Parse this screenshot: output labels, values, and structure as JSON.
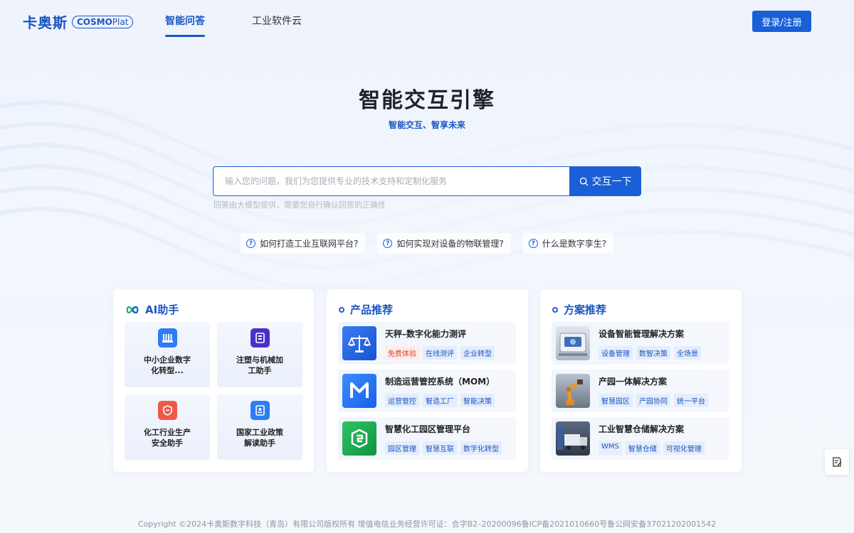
{
  "header": {
    "logo_cn": "卡奥斯",
    "logo_en_a": "COSMO",
    "logo_en_b": "Plat",
    "nav": [
      {
        "label": "智能问答",
        "active": true
      },
      {
        "label": "工业软件云",
        "active": false
      }
    ],
    "login_label": "登录/注册"
  },
  "hero": {
    "title": "智能交互引擎",
    "subtitle": "智能交互、智享未来"
  },
  "search": {
    "placeholder": "输入您的问题，我们为您提供专业的技术支持和定制化服务",
    "button_label": "交互一下",
    "note": "回答由大模型提供，需要您自行确认回答的正确性"
  },
  "questions": [
    "如何打造工业互联网平台?",
    "如何实现对设备的物联管理?",
    "什么是数字孪生?"
  ],
  "ai_assistant": {
    "title": "AI助手",
    "items": [
      {
        "label": "中小企业数字化转型...",
        "icon": "factory-icon",
        "color": "#2f7cf6"
      },
      {
        "label": "注塑与机械加工助手",
        "icon": "machine-icon",
        "color": "#4b2fc9"
      },
      {
        "label": "化工行业生产安全助手",
        "icon": "safety-icon",
        "color": "#ee5a48"
      },
      {
        "label": "国家工业政策解读助手",
        "icon": "policy-icon",
        "color": "#2f7cf6"
      }
    ]
  },
  "products": {
    "title": "产品推荐",
    "items": [
      {
        "name": "天秤–数字化能力测评",
        "icon": "scale-icon",
        "color": "#1e62e0",
        "tags": [
          {
            "text": "免费体验",
            "style": "red"
          },
          {
            "text": "在线测评",
            "style": "blue"
          },
          {
            "text": "企业转型",
            "style": "blue"
          }
        ]
      },
      {
        "name": "制造运营管控系统（MOM）",
        "icon": "mom-logo-icon",
        "color": "#1e6cf0",
        "tags": [
          {
            "text": "运营管控",
            "style": "blue"
          },
          {
            "text": "智造工厂",
            "style": "blue"
          },
          {
            "text": "智能决策",
            "style": "blue"
          }
        ]
      },
      {
        "name": "智慧化工园区管理平台",
        "icon": "park-logo-icon",
        "color": "#18a34a",
        "tags": [
          {
            "text": "园区管理",
            "style": "blue"
          },
          {
            "text": "智慧互联",
            "style": "blue"
          },
          {
            "text": "数字化转型",
            "style": "blue"
          }
        ]
      }
    ]
  },
  "solutions": {
    "title": "方案推荐",
    "items": [
      {
        "name": "设备智能管理解决方案",
        "image": "equipment-photo",
        "tags": [
          {
            "text": "设备管理",
            "style": "blue"
          },
          {
            "text": "数智决策",
            "style": "blue"
          },
          {
            "text": "全场景",
            "style": "blue"
          }
        ]
      },
      {
        "name": "产园一体解决方案",
        "image": "robot-arm-photo",
        "tags": [
          {
            "text": "智慧园区",
            "style": "blue"
          },
          {
            "text": "产园协同",
            "style": "blue"
          },
          {
            "text": "统一平台",
            "style": "blue"
          }
        ]
      },
      {
        "name": "工业智慧仓储解决方案",
        "image": "warehouse-truck-photo",
        "tags": [
          {
            "text": "WMS",
            "style": "blue"
          },
          {
            "text": "智慧仓储",
            "style": "blue"
          },
          {
            "text": "可视化管理",
            "style": "blue"
          }
        ]
      }
    ]
  },
  "footer": {
    "text": "Copyright ©2024卡奥斯数字科技（青岛）有限公司版权所有 增值电信业务经营许可证：合字B2–20200096鲁ICP备2021010660号鲁公网安备37021202001542"
  }
}
